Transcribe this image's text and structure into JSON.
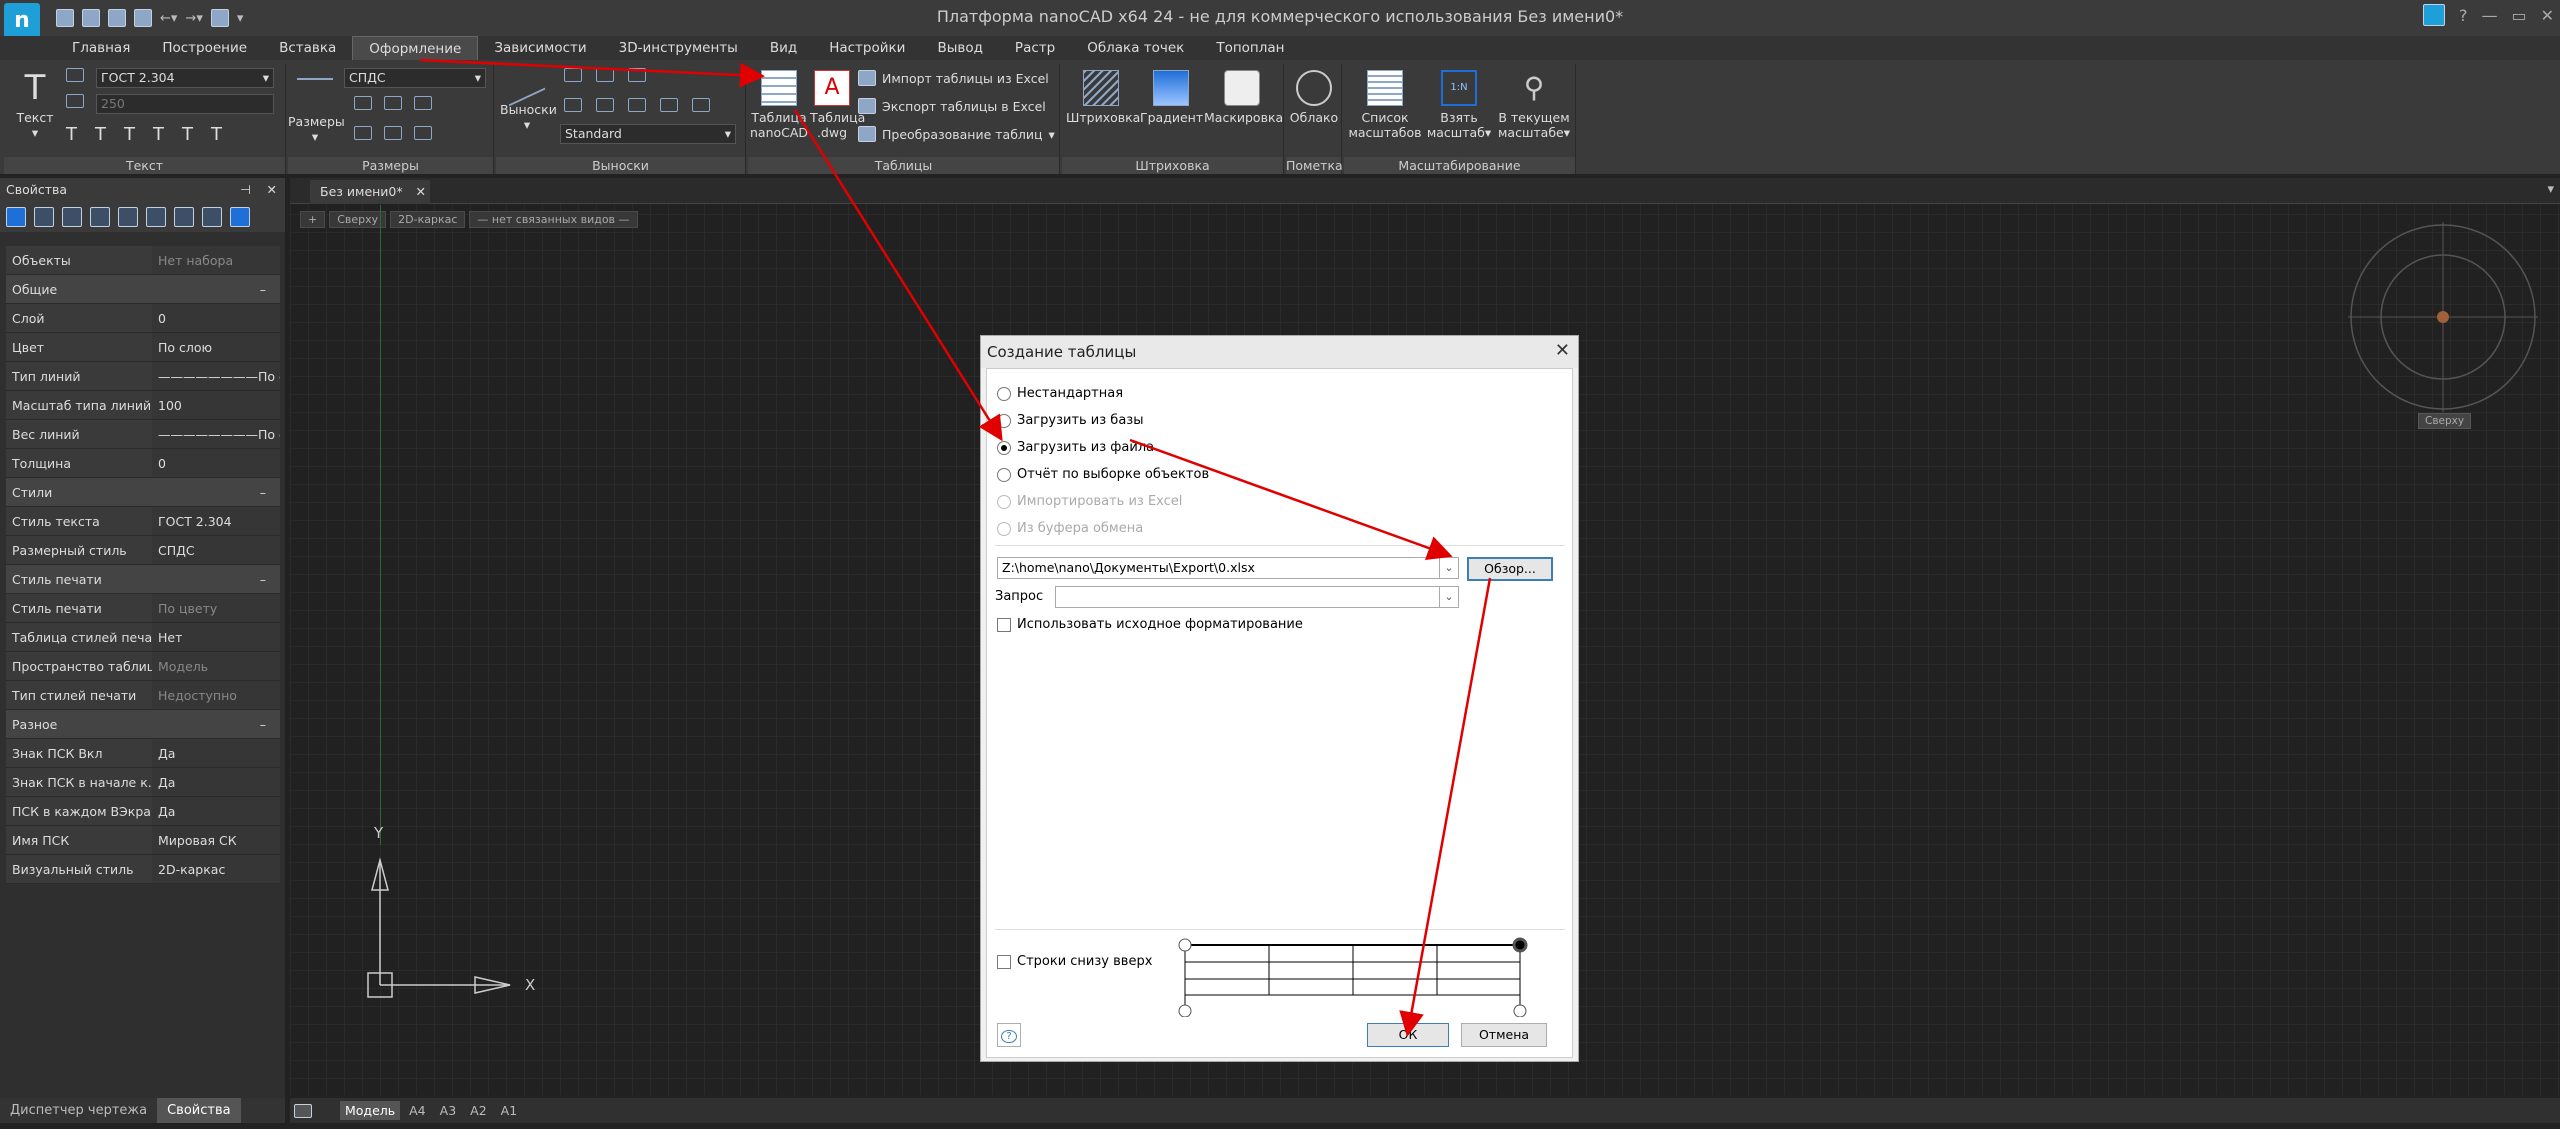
{
  "app": {
    "title": "Платформа nanoCAD x64 24 - не для коммерческого использования Без имени0*",
    "logo": "n"
  },
  "window_controls": {
    "help": "?",
    "minimize": "—",
    "restore": "▭",
    "close": "✕"
  },
  "menu": [
    "Главная",
    "Построение",
    "Вставка",
    "Оформление",
    "Зависимости",
    "3D-инструменты",
    "Вид",
    "Настройки",
    "Вывод",
    "Растр",
    "Облака точек",
    "Топоплан"
  ],
  "ribbon": {
    "text": {
      "big": "Текст",
      "style": "ГОСТ 2.304",
      "height": "250",
      "title": "Текст"
    },
    "dims": {
      "big": "Размеры",
      "style": "СПДС",
      "title": "Размеры"
    },
    "leaders": {
      "big": "Выноски",
      "style": "Standard",
      "title": "Выноски"
    },
    "tables": {
      "nano": "Таблица nanoCAD",
      "dwg": "Таблица .dwg",
      "import": "Импорт таблицы из Excel",
      "export": "Экспорт таблицы в Excel",
      "convert": "Преобразование таблиц",
      "title": "Таблицы"
    },
    "hatch": {
      "hatch": "Штриховка",
      "gradient": "Градиент",
      "mask": "Маскировка",
      "title": "Штриховка"
    },
    "markup": {
      "cloud": "Облако",
      "title": "Пометка"
    },
    "scale": {
      "list": "Список масштабов",
      "take": "Взять масштаб",
      "current": "В текущем масштабе",
      "title": "Масштабирование"
    }
  },
  "properties": {
    "title": "Свойства",
    "rows": [
      {
        "k": "Объекты",
        "v": "Нет набора",
        "dim": true
      },
      {
        "cat": "Общие"
      },
      {
        "k": "Слой",
        "v": "0"
      },
      {
        "k": "Цвет",
        "v": "По слою"
      },
      {
        "k": "Тип линий",
        "v": "————————По с..."
      },
      {
        "k": "Масштаб типа линий",
        "v": "100"
      },
      {
        "k": "Вес линий",
        "v": "————————По с..."
      },
      {
        "k": "Толщина",
        "v": "0"
      },
      {
        "cat": "Стили"
      },
      {
        "k": "Стиль текста",
        "v": "ГОСТ 2.304"
      },
      {
        "k": "Размерный стиль",
        "v": "СПДС"
      },
      {
        "cat": "Стиль печати"
      },
      {
        "k": "Стиль печати",
        "v": "По цвету",
        "dim": true
      },
      {
        "k": "Таблица стилей печати",
        "v": "Нет"
      },
      {
        "k": "Пространство таблиц...",
        "v": "Модель",
        "dim": true
      },
      {
        "k": "Тип стилей печати",
        "v": "Недоступно",
        "dim": true
      },
      {
        "cat": "Разное"
      },
      {
        "k": "Знак ПСК Вкл",
        "v": "Да"
      },
      {
        "k": "Знак ПСК в начале к...",
        "v": "Да"
      },
      {
        "k": "ПСК в каждом ВЭкране",
        "v": "Да"
      },
      {
        "k": "Имя ПСК",
        "v": "Мировая СК"
      },
      {
        "k": "Визуальный стиль",
        "v": "2D-каркас"
      }
    ],
    "collapse": "–",
    "bottom_tabs": [
      "Диспетчер чертежа",
      "Свойства"
    ]
  },
  "document": {
    "tab": "Без имени0*",
    "viewport": [
      "+",
      "Сверху",
      "2D-каркас",
      "— нет связанных видов —"
    ],
    "cube_label": "Сверху",
    "ucs_y": "Y",
    "ucs_x": "X"
  },
  "layouts": [
    "Модель",
    "A4",
    "A3",
    "A2",
    "A1"
  ],
  "dialog": {
    "title": "Создание таблицы",
    "options": [
      {
        "label": "Нестандартная",
        "on": false,
        "dis": false
      },
      {
        "label": "Загрузить из базы",
        "on": false,
        "dis": false
      },
      {
        "label": "Загрузить из файла",
        "on": true,
        "dis": false
      },
      {
        "label": "Отчёт по выборке объектов",
        "on": false,
        "dis": false
      },
      {
        "label": "Импортировать из Excel",
        "on": false,
        "dis": true
      },
      {
        "label": "Из буфера обмена",
        "on": false,
        "dis": true
      }
    ],
    "path": "Z:\\home\\nano\\Документы\\Export\\0.xlsx",
    "browse": "Обзор...",
    "query_label": "Запрос",
    "query_value": "",
    "use_format": "Использовать исходное форматирование",
    "bottom_up": "Строки снизу вверх",
    "help": "?",
    "ok": "ОК",
    "cancel": "Отмена"
  },
  "colors": {
    "arrow": "#e00000",
    "accent": "#1f9fd8"
  }
}
